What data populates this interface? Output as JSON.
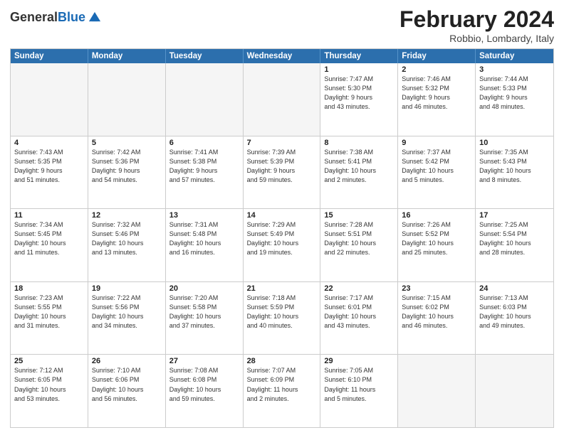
{
  "header": {
    "logo_general": "General",
    "logo_blue": "Blue",
    "month_title": "February 2024",
    "location": "Robbio, Lombardy, Italy"
  },
  "weekdays": [
    "Sunday",
    "Monday",
    "Tuesday",
    "Wednesday",
    "Thursday",
    "Friday",
    "Saturday"
  ],
  "rows": [
    [
      {
        "day": "",
        "info": "",
        "empty": true
      },
      {
        "day": "",
        "info": "",
        "empty": true
      },
      {
        "day": "",
        "info": "",
        "empty": true
      },
      {
        "day": "",
        "info": "",
        "empty": true
      },
      {
        "day": "1",
        "info": "Sunrise: 7:47 AM\nSunset: 5:30 PM\nDaylight: 9 hours\nand 43 minutes.",
        "empty": false
      },
      {
        "day": "2",
        "info": "Sunrise: 7:46 AM\nSunset: 5:32 PM\nDaylight: 9 hours\nand 46 minutes.",
        "empty": false
      },
      {
        "day": "3",
        "info": "Sunrise: 7:44 AM\nSunset: 5:33 PM\nDaylight: 9 hours\nand 48 minutes.",
        "empty": false
      }
    ],
    [
      {
        "day": "4",
        "info": "Sunrise: 7:43 AM\nSunset: 5:35 PM\nDaylight: 9 hours\nand 51 minutes.",
        "empty": false
      },
      {
        "day": "5",
        "info": "Sunrise: 7:42 AM\nSunset: 5:36 PM\nDaylight: 9 hours\nand 54 minutes.",
        "empty": false
      },
      {
        "day": "6",
        "info": "Sunrise: 7:41 AM\nSunset: 5:38 PM\nDaylight: 9 hours\nand 57 minutes.",
        "empty": false
      },
      {
        "day": "7",
        "info": "Sunrise: 7:39 AM\nSunset: 5:39 PM\nDaylight: 9 hours\nand 59 minutes.",
        "empty": false
      },
      {
        "day": "8",
        "info": "Sunrise: 7:38 AM\nSunset: 5:41 PM\nDaylight: 10 hours\nand 2 minutes.",
        "empty": false
      },
      {
        "day": "9",
        "info": "Sunrise: 7:37 AM\nSunset: 5:42 PM\nDaylight: 10 hours\nand 5 minutes.",
        "empty": false
      },
      {
        "day": "10",
        "info": "Sunrise: 7:35 AM\nSunset: 5:43 PM\nDaylight: 10 hours\nand 8 minutes.",
        "empty": false
      }
    ],
    [
      {
        "day": "11",
        "info": "Sunrise: 7:34 AM\nSunset: 5:45 PM\nDaylight: 10 hours\nand 11 minutes.",
        "empty": false
      },
      {
        "day": "12",
        "info": "Sunrise: 7:32 AM\nSunset: 5:46 PM\nDaylight: 10 hours\nand 13 minutes.",
        "empty": false
      },
      {
        "day": "13",
        "info": "Sunrise: 7:31 AM\nSunset: 5:48 PM\nDaylight: 10 hours\nand 16 minutes.",
        "empty": false
      },
      {
        "day": "14",
        "info": "Sunrise: 7:29 AM\nSunset: 5:49 PM\nDaylight: 10 hours\nand 19 minutes.",
        "empty": false
      },
      {
        "day": "15",
        "info": "Sunrise: 7:28 AM\nSunset: 5:51 PM\nDaylight: 10 hours\nand 22 minutes.",
        "empty": false
      },
      {
        "day": "16",
        "info": "Sunrise: 7:26 AM\nSunset: 5:52 PM\nDaylight: 10 hours\nand 25 minutes.",
        "empty": false
      },
      {
        "day": "17",
        "info": "Sunrise: 7:25 AM\nSunset: 5:54 PM\nDaylight: 10 hours\nand 28 minutes.",
        "empty": false
      }
    ],
    [
      {
        "day": "18",
        "info": "Sunrise: 7:23 AM\nSunset: 5:55 PM\nDaylight: 10 hours\nand 31 minutes.",
        "empty": false
      },
      {
        "day": "19",
        "info": "Sunrise: 7:22 AM\nSunset: 5:56 PM\nDaylight: 10 hours\nand 34 minutes.",
        "empty": false
      },
      {
        "day": "20",
        "info": "Sunrise: 7:20 AM\nSunset: 5:58 PM\nDaylight: 10 hours\nand 37 minutes.",
        "empty": false
      },
      {
        "day": "21",
        "info": "Sunrise: 7:18 AM\nSunset: 5:59 PM\nDaylight: 10 hours\nand 40 minutes.",
        "empty": false
      },
      {
        "day": "22",
        "info": "Sunrise: 7:17 AM\nSunset: 6:01 PM\nDaylight: 10 hours\nand 43 minutes.",
        "empty": false
      },
      {
        "day": "23",
        "info": "Sunrise: 7:15 AM\nSunset: 6:02 PM\nDaylight: 10 hours\nand 46 minutes.",
        "empty": false
      },
      {
        "day": "24",
        "info": "Sunrise: 7:13 AM\nSunset: 6:03 PM\nDaylight: 10 hours\nand 49 minutes.",
        "empty": false
      }
    ],
    [
      {
        "day": "25",
        "info": "Sunrise: 7:12 AM\nSunset: 6:05 PM\nDaylight: 10 hours\nand 53 minutes.",
        "empty": false
      },
      {
        "day": "26",
        "info": "Sunrise: 7:10 AM\nSunset: 6:06 PM\nDaylight: 10 hours\nand 56 minutes.",
        "empty": false
      },
      {
        "day": "27",
        "info": "Sunrise: 7:08 AM\nSunset: 6:08 PM\nDaylight: 10 hours\nand 59 minutes.",
        "empty": false
      },
      {
        "day": "28",
        "info": "Sunrise: 7:07 AM\nSunset: 6:09 PM\nDaylight: 11 hours\nand 2 minutes.",
        "empty": false
      },
      {
        "day": "29",
        "info": "Sunrise: 7:05 AM\nSunset: 6:10 PM\nDaylight: 11 hours\nand 5 minutes.",
        "empty": false
      },
      {
        "day": "",
        "info": "",
        "empty": true
      },
      {
        "day": "",
        "info": "",
        "empty": true
      }
    ]
  ]
}
